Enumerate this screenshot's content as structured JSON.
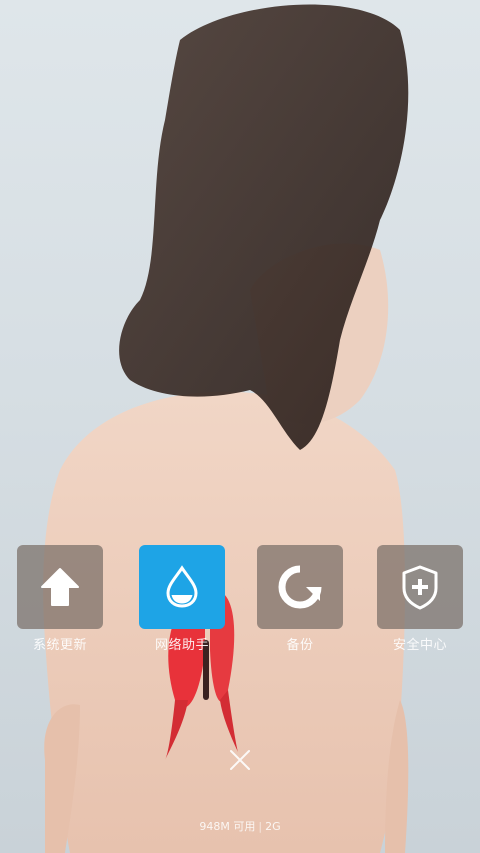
{
  "quick_actions": [
    {
      "label": "系统更新",
      "icon": "arrow-up-icon",
      "active": false
    },
    {
      "label": "网络助手",
      "icon": "water-drop-icon",
      "active": true
    },
    {
      "label": "备份",
      "icon": "backup-icon",
      "active": false
    },
    {
      "label": "安全中心",
      "icon": "shield-plus-icon",
      "active": false
    }
  ],
  "memory": {
    "available": "948M 可用",
    "total": "2G"
  },
  "colors": {
    "accent": "#1ea4e6",
    "tile": "#786e66"
  }
}
